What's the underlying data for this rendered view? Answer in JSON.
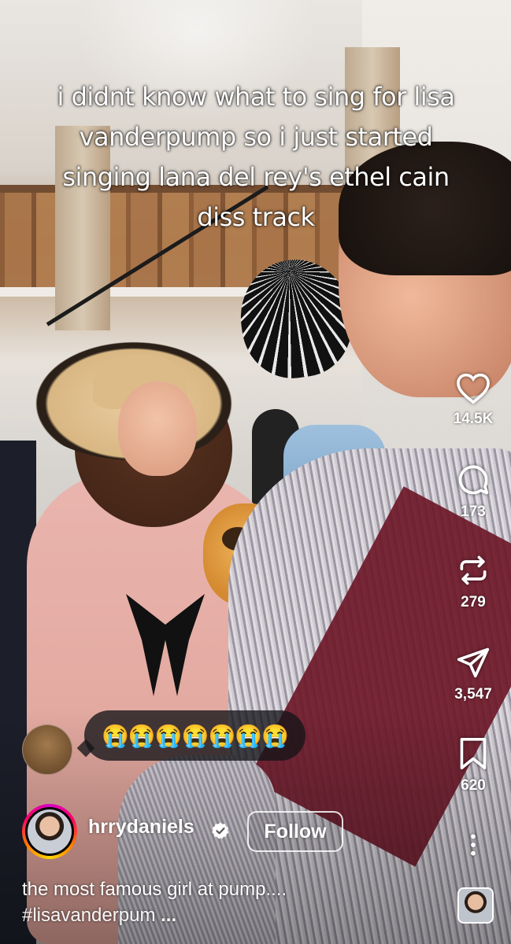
{
  "video": {
    "overlay_caption": "i didnt know what to sing for lisa vanderpump so i just started singing lana del rey's ethel cain diss track"
  },
  "actions": {
    "like": {
      "icon": "heart-icon",
      "count": "14.5K"
    },
    "comment": {
      "icon": "comment-icon",
      "count": "173"
    },
    "repost": {
      "icon": "repost-icon",
      "count": "279"
    },
    "share": {
      "icon": "send-icon",
      "count": "3,547"
    },
    "save": {
      "icon": "bookmark-icon",
      "count": "620"
    },
    "more": {
      "icon": "more-vertical-icon"
    }
  },
  "comment_preview": {
    "text": "😭😭😭😭😭😭😭"
  },
  "author": {
    "username": "hrrydaniels",
    "verified": true,
    "follow_label": "Follow"
  },
  "description": {
    "line1": "the most famous girl at pump....",
    "hashtag": "#lisavanderpum",
    "more": "..."
  },
  "colors": {
    "overlay_text": "#ffffff",
    "story_ring": [
      "#d300c5",
      "#ff0069",
      "#ff7a00",
      "#ffd600"
    ]
  }
}
